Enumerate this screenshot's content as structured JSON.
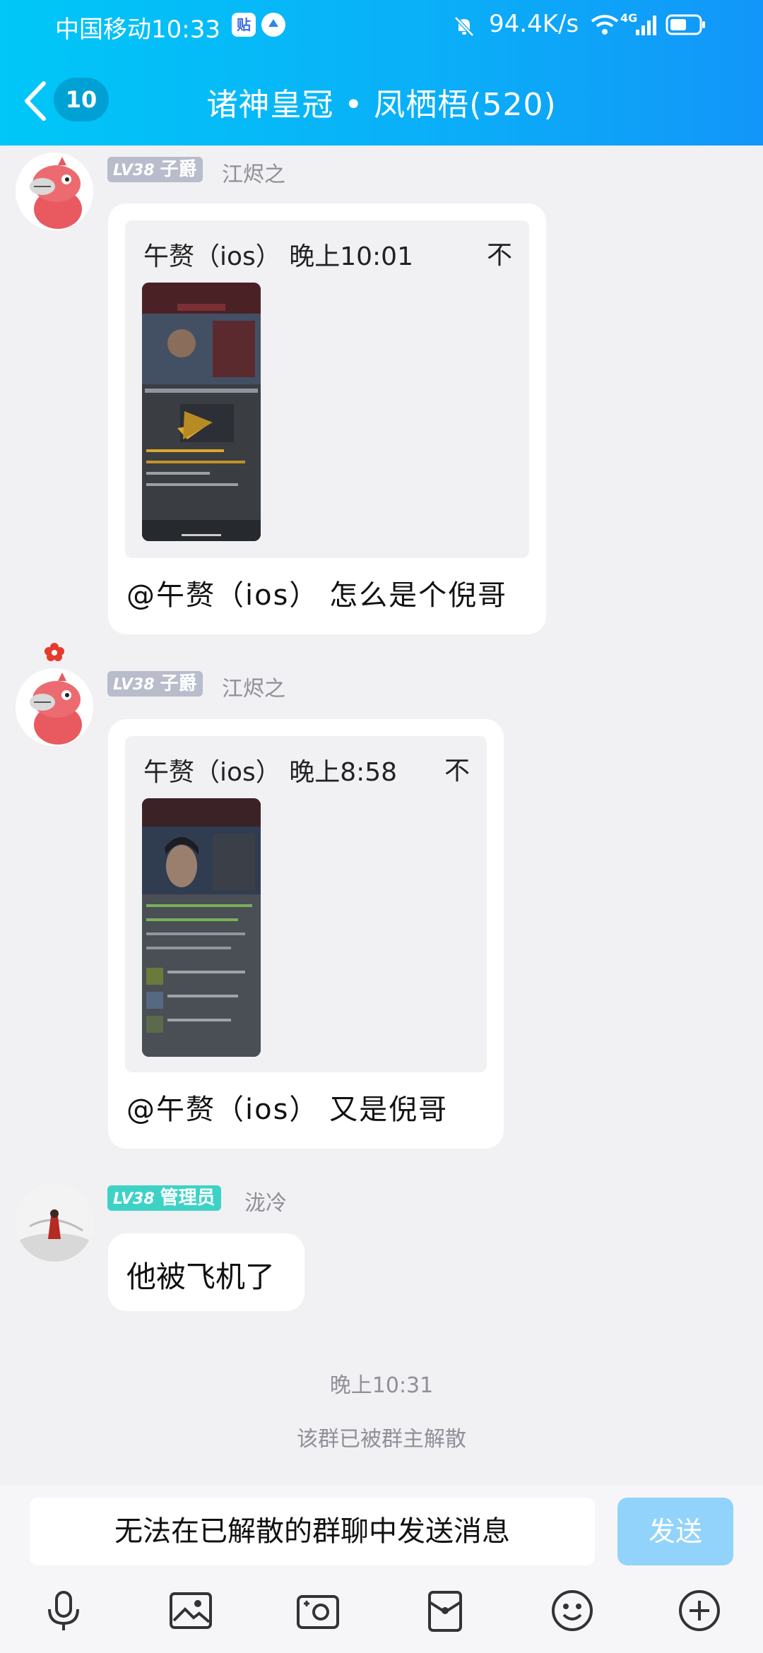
{
  "status_bar": {
    "carrier": "中国移动",
    "time": "10:33",
    "badge1": "贴",
    "net_speed": "94.4K/s",
    "net_type": "4G"
  },
  "nav": {
    "unread_count": "10",
    "title": "诸神皇冠 • 凤栖梧(520)"
  },
  "messages": [
    {
      "level": "LV38",
      "title": "子爵",
      "sender": "江烬之",
      "quote_author_time": "午赘（ios） 晚上10:01",
      "quote_pin": "不",
      "text": "@午赘（ios） 怎么是个倪哥"
    },
    {
      "level": "LV38",
      "title": "子爵",
      "sender": "江烬之",
      "quote_author_time": "午赘（ios） 晚上8:58",
      "quote_pin": "不",
      "text": "@午赘（ios） 又是倪哥"
    },
    {
      "level": "LV38",
      "title": "管理员",
      "sender": "泷冷",
      "text": "他被飞机了"
    }
  ],
  "time_separator": "晚上10:31",
  "system_notice": "该群已被群主解散",
  "input": {
    "placeholder": "无法在已解散的群聊中发送消息",
    "send_label": "发送"
  },
  "toolbar": [
    "microphone-icon",
    "image-icon",
    "camera-icon",
    "red-packet-icon",
    "emoji-icon",
    "plus-icon"
  ],
  "colors": {
    "header_start": "#00c7f7",
    "header_end": "#1296f9",
    "admin_badge": "#3ed2c6",
    "level_badge": "#b8bccb",
    "send_disabled": "#92d3fb"
  }
}
